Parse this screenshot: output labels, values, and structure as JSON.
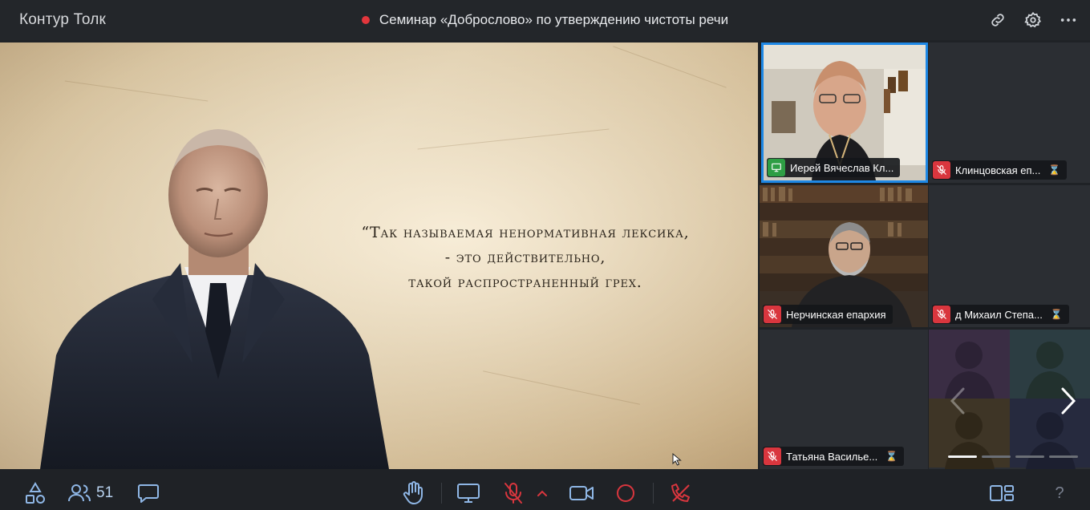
{
  "app": {
    "name": "Контур Толк",
    "meeting_title": "Семинар «Доброслово» по утверждению чистоты речи",
    "recording_color": "#e3363c"
  },
  "title_actions": [
    {
      "icon": "link-icon"
    },
    {
      "icon": "gear-icon"
    },
    {
      "icon": "more-horizontal-icon"
    }
  ],
  "slide": {
    "quote_lines": [
      "“Так называемая ненормативная лексика,",
      "- это действительно,",
      "такой распространенный грех."
    ]
  },
  "participants": [
    {
      "name": "Иерей Вячеслав Кл...",
      "mic": "screen-share",
      "active": true,
      "awaiting": false
    },
    {
      "name": "Клинцовская еп...",
      "mic": "muted",
      "active": false,
      "awaiting": true,
      "hourglass": "⌛"
    },
    {
      "name": "Нерчинская епархия",
      "mic": "muted",
      "active": false,
      "awaiting": false
    },
    {
      "name": "д Михаил Степа...",
      "mic": "muted",
      "active": false,
      "awaiting": true,
      "hourglass": "⌛"
    },
    {
      "name": "Татьяна Василье...",
      "mic": "muted",
      "active": false,
      "awaiting": true,
      "hourglass": "⌛"
    }
  ],
  "carousel": {
    "pages": 4,
    "current": 1
  },
  "toolbar": {
    "participants_count": "51",
    "help_label": "?",
    "accent": "#1e88e5",
    "danger": "#d9363e"
  }
}
